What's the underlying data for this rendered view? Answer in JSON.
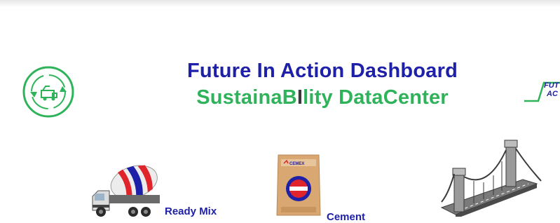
{
  "header": {
    "title_line1": "Future In Action Dashboard",
    "title_line2_a": "SustainaB",
    "title_line2_b": "I",
    "title_line2_c": "lity DataCenter"
  },
  "logo_right": {
    "line1": "FUT",
    "line2": "AC"
  },
  "categories": [
    {
      "label": "Ready Mix"
    },
    {
      "label": "Cement"
    },
    {
      "label": ""
    }
  ],
  "bag_brand": "CEMEX",
  "colors": {
    "title_blue": "#1e20a8",
    "title_green": "#2fb35a",
    "accent_red": "#e0242b",
    "bag_tan": "#d9a872"
  },
  "icons": {
    "logo_left": "recycle-circle-icon",
    "truck": "concrete-mixer-truck-icon",
    "bag": "cement-bag-icon",
    "bridge": "bridge-icon"
  }
}
